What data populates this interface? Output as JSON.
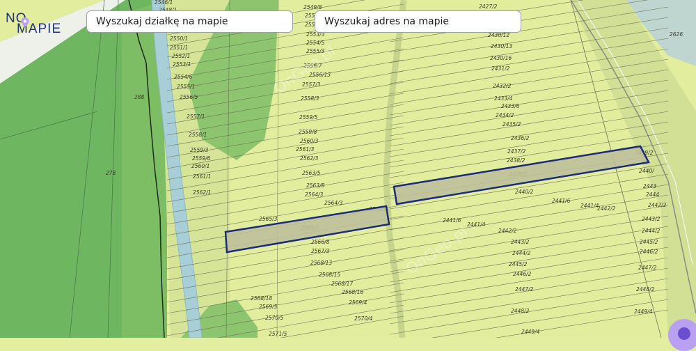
{
  "logo": {
    "line1": "NO",
    "line2": "MAPIE"
  },
  "search": {
    "parcel_label": "Wyszukaj działkę na mapie",
    "address_label": "Wyszukaj adres na mapie"
  },
  "watermark": "OnGeo.pl",
  "colors": {
    "selection": "#1c2a7a",
    "logo": "#23327a",
    "fab": "#b9a0f0"
  },
  "parcels": {
    "left_column": [
      "2546/1",
      "2548/1",
      "2550/1",
      "2551/1",
      "2552/1",
      "2553/1",
      "2554/6",
      "2555/1",
      "2556/5",
      "2557/1",
      "2558/1",
      "2559/3",
      "2559/6",
      "2560/1",
      "2561/1",
      "2562/1"
    ],
    "middle_column": [
      "2549/8",
      "2551/5",
      "2552/3",
      "2553/3",
      "2554/5",
      "2555/3",
      "2556/7",
      "2556/13",
      "2557/3",
      "2558/3",
      "2559/5",
      "2559/8",
      "2560/3",
      "2561/3",
      "2562/3",
      "2563/5",
      "2563/8",
      "2564/3",
      "2564/3",
      "2565/3",
      "2565/3",
      "2566/5",
      "2566/8",
      "2567/3",
      "2568/13",
      "2568/15",
      "2568/17",
      "2568/16",
      "2568/18",
      "2569/5",
      "2569/4",
      "2570/5",
      "2570/4",
      "2571/5"
    ],
    "right_column": [
      "2427/2",
      "2430/12",
      "2430/13",
      "2430/16",
      "2431/2",
      "2432/2",
      "2433/4",
      "2433/6",
      "2434/2",
      "2435/2",
      "2436/2",
      "2437/2",
      "2438/2",
      "2439/2",
      "2439/2",
      "2440/",
      "2440/2",
      "2441/6",
      "2441/4",
      "2442/2",
      "2441/6",
      "2441/4",
      "2442/2",
      "2443/2",
      "2444/2",
      "2445/2",
      "2446/2",
      "2447/2",
      "2448/2",
      "2449/4",
      "2449/4",
      "2443",
      "2444",
      "2442/2",
      "2443/2",
      "2444/2",
      "2445/2",
      "2446/2",
      "2447/2",
      "2448/2"
    ],
    "other": [
      "288",
      "278",
      "2626"
    ]
  }
}
